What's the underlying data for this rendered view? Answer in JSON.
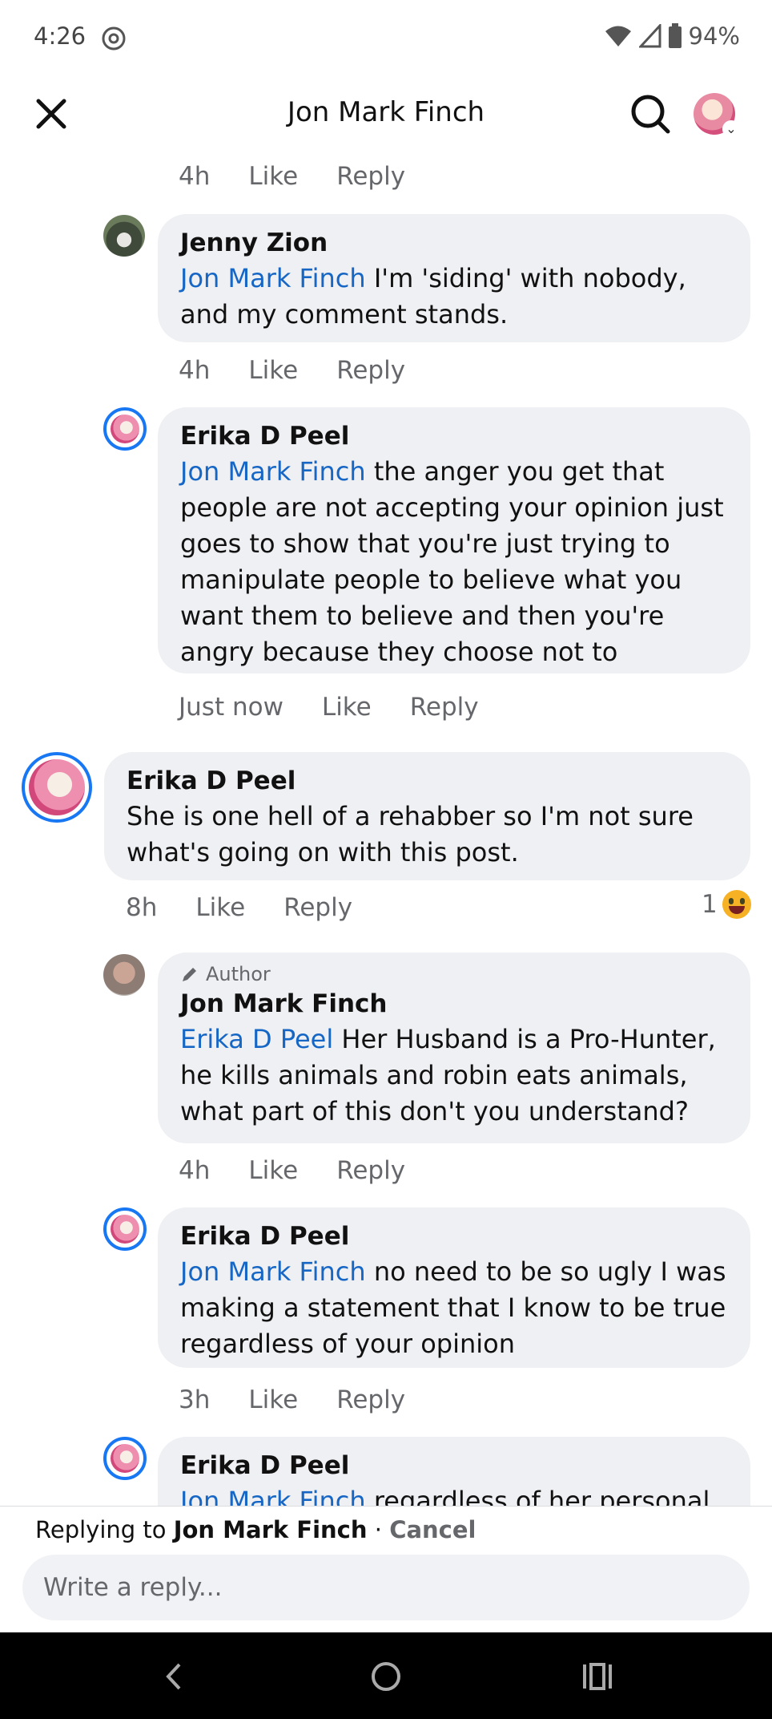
{
  "status": {
    "time": "4:26",
    "battery": "94%"
  },
  "header": {
    "title": "Jon Mark Finch"
  },
  "thread": {
    "top_meta": {
      "time": "4h",
      "like": "Like",
      "reply": "Reply"
    },
    "comments": [
      {
        "name": "Jenny Zion",
        "mention": "Jon Mark Finch",
        "text": " I'm 'siding' with nobody, and my comment stands.",
        "time": "4h",
        "like": "Like",
        "reply": "Reply"
      },
      {
        "name": "Erika D Peel",
        "mention": "Jon Mark Finch",
        "text": " the anger you get that people are not accepting your opinion just goes to show that you're just trying to manipulate people to believe what you want them to believe and then you're angry because they choose not to",
        "time": "Just now",
        "like": "Like",
        "reply": "Reply"
      },
      {
        "name": "Erika D Peel",
        "text": "She is one hell of a rehabber so I'm not sure what's going on with this post.",
        "time": "8h",
        "like": "Like",
        "reply": "Reply",
        "reaction_count": "1"
      },
      {
        "badge": "Author",
        "name": "Jon Mark Finch",
        "mention": "Erika D Peel",
        "text": " Her Husband is a Pro-Hunter, he kills animals and robin eats animals, what part of this don't you understand?",
        "time": "4h",
        "like": "Like",
        "reply": "Reply"
      },
      {
        "name": "Erika D Peel",
        "mention": "Jon Mark Finch",
        "text": " no need to be so ugly I was making a statement that I know to be true regardless of your opinion",
        "time": "3h",
        "like": "Like",
        "reply": "Reply"
      },
      {
        "name": "Erika D Peel",
        "mention": "Jon Mark Finch",
        "text": " regardless of her personal"
      }
    ]
  },
  "reply_bar": {
    "prefix": "Replying to ",
    "target": "Jon Mark Finch",
    "separator": " · ",
    "cancel": "Cancel",
    "placeholder": "Write a reply..."
  },
  "colors": {
    "mention": "#1666c5",
    "bubble": "#eff0f3",
    "meta": "#65676b",
    "ring": "#1877f2"
  }
}
